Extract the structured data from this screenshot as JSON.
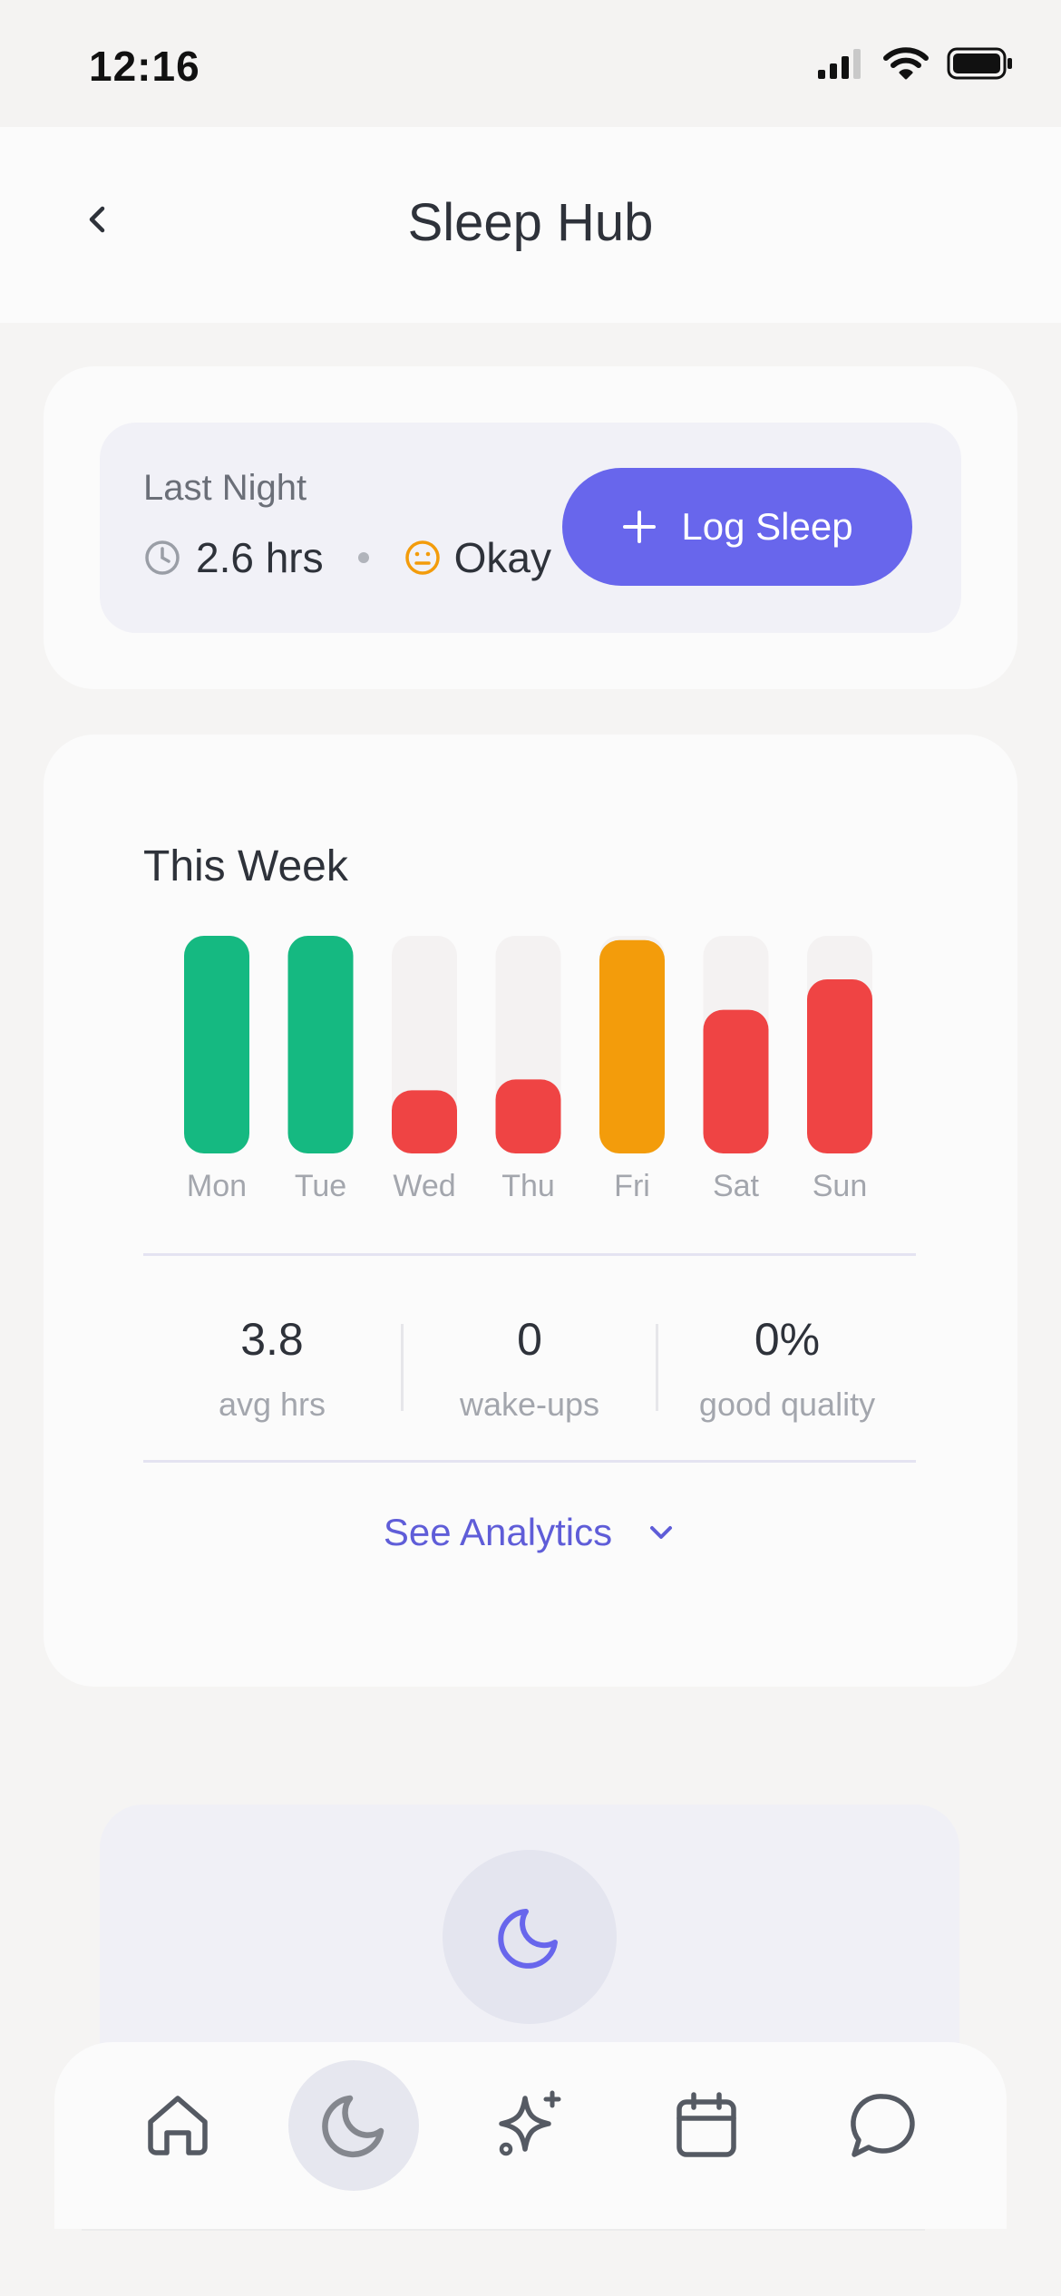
{
  "status_bar": {
    "time": "12:16"
  },
  "header": {
    "title": "Sleep Hub"
  },
  "last_night": {
    "label": "Last Night",
    "hours": "2.6 hrs",
    "quality": "Okay",
    "log_button": "Log Sleep"
  },
  "week": {
    "title": "This Week",
    "stats": [
      {
        "value": "3.8",
        "label": "avg hrs"
      },
      {
        "value": "0",
        "label": "wake-ups"
      },
      {
        "value": "0%",
        "label": "good quality"
      }
    ],
    "see_analytics": "See Analytics"
  },
  "colors": {
    "good": "#15b981",
    "okay": "#f39c0b",
    "poor": "#ef4444",
    "track": "#f4f2f2",
    "accent": "#6866ec"
  },
  "chart_data": {
    "type": "bar",
    "categories": [
      "Mon",
      "Tue",
      "Wed",
      "Thu",
      "Fri",
      "Sat",
      "Sun"
    ],
    "values": [
      1.0,
      1.0,
      0.29,
      0.34,
      0.98,
      0.66,
      0.8
    ],
    "quality": [
      "good",
      "good",
      "poor",
      "poor",
      "okay",
      "poor",
      "poor"
    ],
    "ylim": [
      0,
      1
    ],
    "grid": false
  },
  "nav": {
    "items": [
      {
        "name": "home-icon",
        "active": false
      },
      {
        "name": "moon-icon",
        "active": true
      },
      {
        "name": "sparkle-icon",
        "active": false
      },
      {
        "name": "calendar-icon",
        "active": false
      },
      {
        "name": "chat-icon",
        "active": false
      }
    ]
  }
}
